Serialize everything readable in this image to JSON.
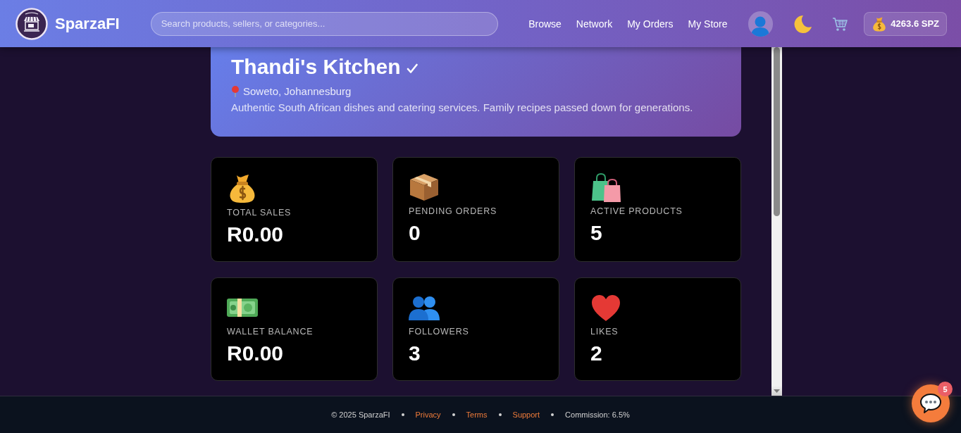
{
  "header": {
    "brand": "SparzaFI",
    "search": {
      "placeholder": "Search products, sellers, or categories..."
    },
    "nav": [
      "Browse",
      "Network",
      "My Orders",
      "My Store"
    ],
    "wallet": {
      "balance": "4263.6 SPZ"
    }
  },
  "store": {
    "name": "Thandi's Kitchen",
    "verified": true,
    "location": "Soweto, Johannesburg",
    "description": "Authentic South African dishes and catering services. Family recipes passed down for generations."
  },
  "stats": [
    {
      "kind": "sales",
      "label": "TOTAL SALES",
      "value": "R0.00"
    },
    {
      "kind": "orders",
      "label": "PENDING ORDERS",
      "value": "0"
    },
    {
      "kind": "products",
      "label": "ACTIVE PRODUCTS",
      "value": "5"
    },
    {
      "kind": "wallet",
      "label": "WALLET BALANCE",
      "value": "R0.00"
    },
    {
      "kind": "followers",
      "label": "FOLLOWERS",
      "value": "3"
    },
    {
      "kind": "likes",
      "label": "LIKES",
      "value": "2"
    }
  ],
  "footer": {
    "items": [
      {
        "kind": "text",
        "label": "© 2025 SparzaFI"
      },
      {
        "kind": "link",
        "label": "Privacy"
      },
      {
        "kind": "link",
        "label": "Terms"
      },
      {
        "kind": "link",
        "label": "Support"
      },
      {
        "kind": "text",
        "label": "Commission: 6.5%"
      }
    ]
  },
  "chat": {
    "unread": "5"
  }
}
